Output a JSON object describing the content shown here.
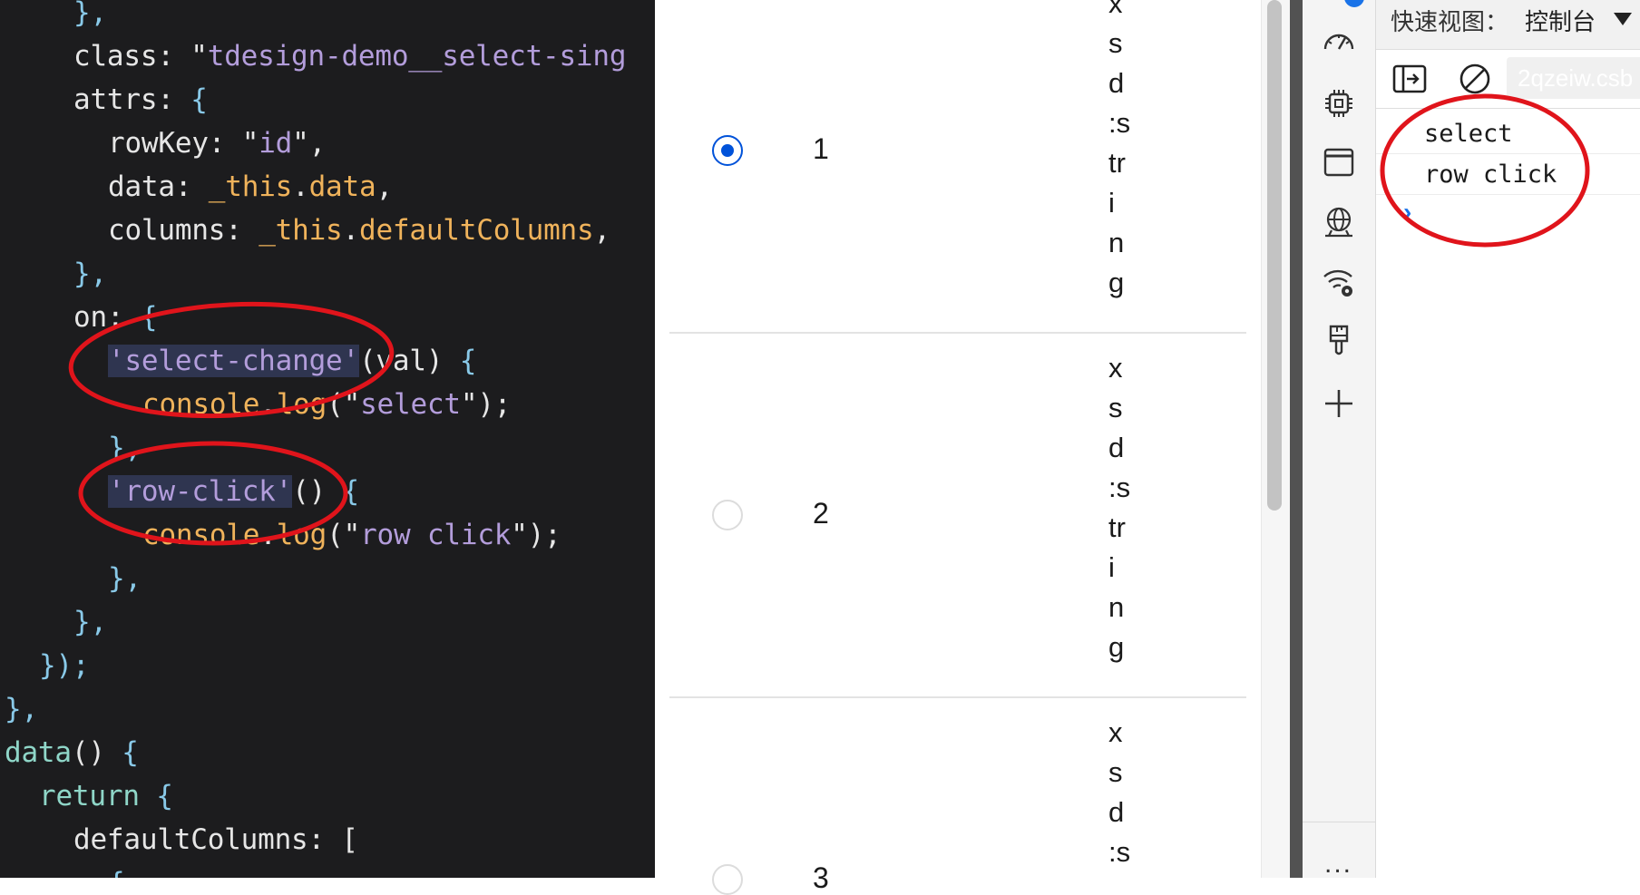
{
  "editor": {
    "lines": [
      {
        "indent": 3,
        "tokens": [
          {
            "t": "},",
            "c": "t-brace"
          }
        ]
      },
      {
        "indent": 3,
        "tokens": [
          {
            "t": "class",
            "c": "t-key"
          },
          {
            "t": ": ",
            "c": "t-punc"
          },
          {
            "t": "\"",
            "c": "t-str-q"
          },
          {
            "t": "tdesign-demo__select-sing",
            "c": "t-str"
          }
        ]
      },
      {
        "indent": 3,
        "tokens": [
          {
            "t": "attrs",
            "c": "t-key"
          },
          {
            "t": ": ",
            "c": "t-punc"
          },
          {
            "t": "{",
            "c": "t-brace"
          }
        ]
      },
      {
        "indent": 4,
        "tokens": [
          {
            "t": "rowKey",
            "c": "t-key"
          },
          {
            "t": ": ",
            "c": "t-punc"
          },
          {
            "t": "\"",
            "c": "t-str-q"
          },
          {
            "t": "id",
            "c": "t-str"
          },
          {
            "t": "\",",
            "c": "t-str-q"
          }
        ]
      },
      {
        "indent": 4,
        "tokens": [
          {
            "t": "data",
            "c": "t-key"
          },
          {
            "t": ": ",
            "c": "t-punc"
          },
          {
            "t": "_this",
            "c": "t-this"
          },
          {
            "t": ".",
            "c": "t-punc"
          },
          {
            "t": "data",
            "c": "t-prop"
          },
          {
            "t": ",",
            "c": "t-punc"
          }
        ]
      },
      {
        "indent": 4,
        "tokens": [
          {
            "t": "columns",
            "c": "t-key"
          },
          {
            "t": ": ",
            "c": "t-punc"
          },
          {
            "t": "_this",
            "c": "t-this"
          },
          {
            "t": ".",
            "c": "t-punc"
          },
          {
            "t": "defaultColumns",
            "c": "t-prop"
          },
          {
            "t": ",",
            "c": "t-punc"
          }
        ]
      },
      {
        "indent": 3,
        "tokens": [
          {
            "t": "},",
            "c": "t-brace"
          }
        ]
      },
      {
        "indent": 3,
        "tokens": [
          {
            "t": "on",
            "c": "t-key"
          },
          {
            "t": ": ",
            "c": "t-punc"
          },
          {
            "t": "{",
            "c": "t-brace"
          }
        ]
      },
      {
        "indent": 4,
        "tokens": [
          {
            "t": "'select-change'",
            "c": "t-evt"
          },
          {
            "t": "(val) ",
            "c": "t-punc"
          },
          {
            "t": "{",
            "c": "t-brace"
          }
        ]
      },
      {
        "indent": 5,
        "tokens": [
          {
            "t": "console",
            "c": "t-console"
          },
          {
            "t": ".",
            "c": "t-punc"
          },
          {
            "t": "log",
            "c": "t-console"
          },
          {
            "t": "(\"",
            "c": "t-punc"
          },
          {
            "t": "select",
            "c": "t-str"
          },
          {
            "t": "\");",
            "c": "t-punc"
          }
        ]
      },
      {
        "indent": 4,
        "tokens": [
          {
            "t": "},",
            "c": "t-brace"
          }
        ]
      },
      {
        "indent": 4,
        "tokens": [
          {
            "t": "'row-click'",
            "c": "t-evt"
          },
          {
            "t": "() ",
            "c": "t-punc"
          },
          {
            "t": "{",
            "c": "t-brace"
          }
        ]
      },
      {
        "indent": 5,
        "tokens": [
          {
            "t": "console",
            "c": "t-console"
          },
          {
            "t": ".",
            "c": "t-punc"
          },
          {
            "t": "log",
            "c": "t-console"
          },
          {
            "t": "(\"",
            "c": "t-punc"
          },
          {
            "t": "row click",
            "c": "t-str"
          },
          {
            "t": "\");",
            "c": "t-punc"
          }
        ]
      },
      {
        "indent": 4,
        "tokens": [
          {
            "t": "},",
            "c": "t-brace"
          }
        ]
      },
      {
        "indent": 3,
        "tokens": [
          {
            "t": "},",
            "c": "t-brace"
          }
        ]
      },
      {
        "indent": 2,
        "tokens": [
          {
            "t": "});",
            "c": "t-brace"
          }
        ]
      },
      {
        "indent": 1,
        "tokens": [
          {
            "t": "},",
            "c": "t-brace"
          }
        ]
      },
      {
        "indent": 1,
        "tokens": [
          {
            "t": "data",
            "c": "t-fn"
          },
          {
            "t": "() ",
            "c": "t-punc"
          },
          {
            "t": "{",
            "c": "t-brace"
          }
        ]
      },
      {
        "indent": 2,
        "tokens": [
          {
            "t": "return",
            "c": "t-fn"
          },
          {
            "t": " ",
            "c": "t-punc"
          },
          {
            "t": "{",
            "c": "t-brace"
          }
        ]
      },
      {
        "indent": 3,
        "tokens": [
          {
            "t": "defaultColumns",
            "c": "t-key"
          },
          {
            "t": ": [",
            "c": "t-punc"
          }
        ]
      },
      {
        "indent": 4,
        "tokens": [
          {
            "t": "{",
            "c": "t-brace"
          }
        ]
      }
    ]
  },
  "table": {
    "rows": [
      {
        "index": "1",
        "checked": true,
        "cell": [
          "x",
          "s",
          "d",
          ":s",
          "tr",
          "i",
          "n",
          "g"
        ]
      },
      {
        "index": "2",
        "checked": false,
        "cell": [
          "x",
          "s",
          "d",
          ":s",
          "tr",
          "i",
          "n",
          "g"
        ]
      },
      {
        "index": "3",
        "checked": false,
        "cell": [
          "x",
          "s",
          "d",
          ":s"
        ]
      }
    ]
  },
  "devtools": {
    "quick_view_label": "快速视图：",
    "quick_view_value": "控制台",
    "filter_value": "2qzeiw.csb",
    "console_logs": [
      "select",
      "row click"
    ],
    "rail_icons": [
      "performance-icon",
      "cpu-icon",
      "window-icon",
      "network-icon",
      "wifi-settings-icon",
      "brush-icon",
      "add-icon"
    ],
    "more_label": "..."
  },
  "annotations": {
    "color": "#e0141b"
  }
}
